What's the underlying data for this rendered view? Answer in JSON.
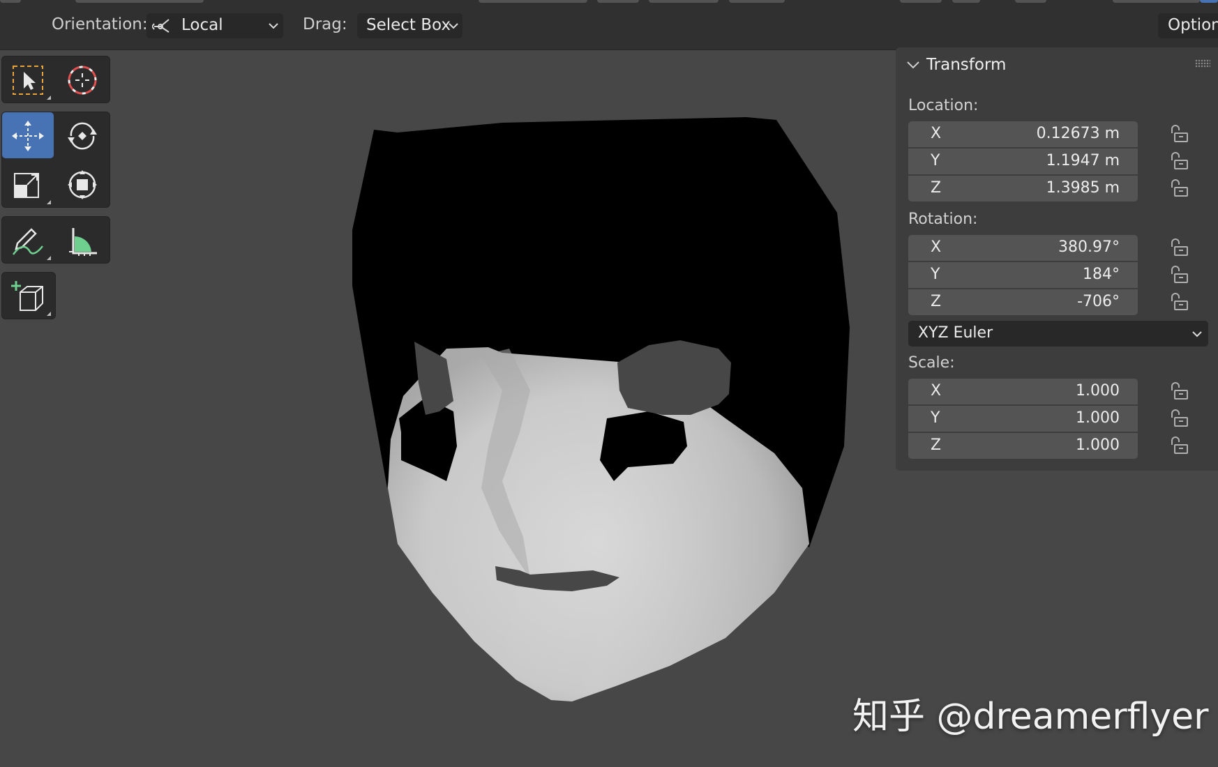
{
  "header": {
    "orientation_label": "Orientation:",
    "orientation_value": "Local",
    "drag_label": "Drag:",
    "drag_value": "Select Box",
    "options_label": "Options"
  },
  "toolbar": {
    "tools": [
      {
        "name": "select-box-tool",
        "icon": "select-box-icon",
        "active": false
      },
      {
        "name": "cursor-tool",
        "icon": "cursor-icon",
        "active": false
      },
      {
        "name": "move-tool",
        "icon": "move-icon",
        "active": true
      },
      {
        "name": "rotate-tool",
        "icon": "rotate-icon",
        "active": false
      },
      {
        "name": "scale-tool",
        "icon": "scale-icon",
        "active": false
      },
      {
        "name": "transform-tool",
        "icon": "transform-icon",
        "active": false
      },
      {
        "name": "annotate-tool",
        "icon": "annotate-icon",
        "active": false
      },
      {
        "name": "measure-tool",
        "icon": "measure-icon",
        "active": false
      },
      {
        "name": "add-cube-tool",
        "icon": "add-cube-icon",
        "active": false
      }
    ]
  },
  "panel": {
    "title": "Transform",
    "location": {
      "label": "Location:",
      "x": {
        "axis": "X",
        "value": "0.12673 m"
      },
      "y": {
        "axis": "Y",
        "value": "1.1947 m"
      },
      "z": {
        "axis": "Z",
        "value": "1.3985 m"
      }
    },
    "rotation": {
      "label": "Rotation:",
      "x": {
        "axis": "X",
        "value": "380.97°"
      },
      "y": {
        "axis": "Y",
        "value": "184°"
      },
      "z": {
        "axis": "Z",
        "value": "-706°"
      },
      "mode": "XYZ Euler"
    },
    "scale": {
      "label": "Scale:",
      "x": {
        "axis": "X",
        "value": "1.000"
      },
      "y": {
        "axis": "Y",
        "value": "1.000"
      },
      "z": {
        "axis": "Z",
        "value": "1.000"
      }
    }
  },
  "watermark": "知乎 @dreamerflyer",
  "colors": {
    "viewport_bg": "#474747",
    "active_tool": "#4772b3",
    "panel_bg": "#3d3d3d",
    "field_bg": "#545454"
  }
}
